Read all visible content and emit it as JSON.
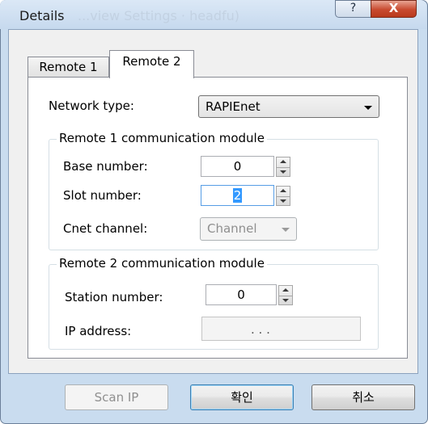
{
  "window": {
    "title": "Details",
    "ghost_title": "...view Settings · headfu)"
  },
  "titlebar": {
    "help_glyph": "?",
    "close_glyph": "X"
  },
  "tabs": [
    {
      "label": "Remote 1",
      "selected": false
    },
    {
      "label": "Remote 2",
      "selected": true
    }
  ],
  "network": {
    "label": "Network type:",
    "value": "RAPIEnet"
  },
  "remote1_group": {
    "title": "Remote 1 communication module",
    "base": {
      "label": "Base number:",
      "value": "0"
    },
    "slot": {
      "label": "Slot number:",
      "value": "2"
    },
    "cnet": {
      "label": "Cnet channel:",
      "value": "Channel"
    }
  },
  "remote2_group": {
    "title": "Remote 2 communication module",
    "station": {
      "label": "Station number:",
      "value": "0"
    },
    "ip": {
      "label": "IP address:",
      "value": " .  .  . "
    }
  },
  "buttons": {
    "scan_ip": "Scan IP",
    "ok": "확인",
    "cancel": "취소"
  },
  "colors": {
    "selection": "#3399ff",
    "close_button": "#c84a2f"
  }
}
